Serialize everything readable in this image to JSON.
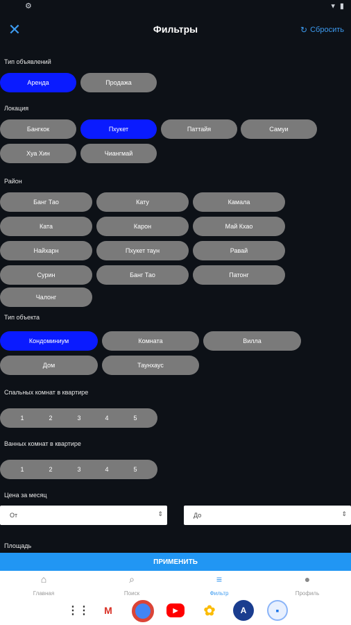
{
  "status": {
    "time": "",
    "gear": "⚙",
    "right": ""
  },
  "header": {
    "title": "Фильтры",
    "reset_label": "Сбросить"
  },
  "listing_type": {
    "title": "Тип объявлений",
    "options": [
      "Аренда",
      "Продажа"
    ],
    "selected": "Аренда"
  },
  "location": {
    "title": "Локация",
    "options": [
      "Бангкок",
      "Пхукет",
      "Паттайя",
      "Самуи",
      "Хуа Хин",
      "Чиангмай"
    ],
    "selected": "Пхукет"
  },
  "district": {
    "title": "Район",
    "options": [
      "Банг Тао",
      "Кату",
      "Камала",
      "Ката",
      "Карон",
      "Май Кхао",
      "Найхарн",
      "Пхукет таун",
      "Равай",
      "Сурин",
      "Банг Тао",
      "Патонг",
      "Чалонг"
    ]
  },
  "object_type": {
    "title": "Тип объекта",
    "options": [
      "Кондоминиум",
      "Комната",
      "Вилла",
      "Дом",
      "Таунхаус"
    ],
    "selected": "Кондоминиум"
  },
  "bedrooms": {
    "title": "Спальных комнат в квартире",
    "values": [
      "1",
      "2",
      "3",
      "4",
      "5"
    ]
  },
  "bathrooms": {
    "title": "Ванных комнат в квартире",
    "values": [
      "1",
      "2",
      "3",
      "4",
      "5"
    ]
  },
  "price": {
    "title": "Цена за месяц",
    "from_placeholder": "От",
    "to_placeholder": "До"
  },
  "area": {
    "title": "Площадь"
  },
  "apply_label": "ПРИМЕНИТЬ",
  "nav": [
    {
      "label": "Главная",
      "icon": "home-icon"
    },
    {
      "label": "Поиск",
      "icon": "search-icon"
    },
    {
      "label": "Фильтр",
      "icon": "filter-icon"
    },
    {
      "label": "Профиль",
      "icon": "profile-icon"
    }
  ],
  "nav_active": "Фильтр",
  "accent": "#0a1bff",
  "link_color": "#3d9bf0",
  "apply_color": "#2196f3"
}
